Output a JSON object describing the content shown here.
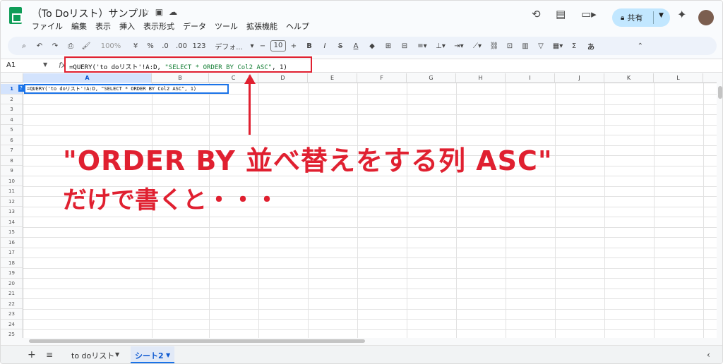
{
  "doc": {
    "title": "（To Doリスト）サンプル"
  },
  "menu": [
    "ファイル",
    "編集",
    "表示",
    "挿入",
    "表示形式",
    "データ",
    "ツール",
    "拡張機能",
    "ヘルプ"
  ],
  "share": {
    "label": "共有"
  },
  "toolbar": {
    "zoom": "100%",
    "currency": "¥",
    "percent": "%",
    "dec_dec": ".0",
    "dec_inc": ".00",
    "num_fmt": "123",
    "font": "デフォ...",
    "font_size": "10",
    "bold": "B",
    "italic": "I",
    "strike": "S",
    "text_color": "A",
    "sigma": "Σ",
    "input_mode": "あ"
  },
  "formula_bar": {
    "cell_ref": "A1",
    "fx": "fx",
    "formula_prefix": "=QUERY(",
    "formula_sheet": "'to doリスト'!A:D, ",
    "formula_str": "\"SELECT * ORDER BY Col2 ASC\"",
    "formula_suffix": ", 1)"
  },
  "columns": [
    "A",
    "B",
    "C",
    "D",
    "E",
    "F",
    "G",
    "H",
    "I",
    "J",
    "K",
    "L"
  ],
  "rows": [
    "1",
    "2",
    "3",
    "4",
    "5",
    "6",
    "7",
    "8",
    "9",
    "10",
    "11",
    "12",
    "13",
    "14",
    "15",
    "16",
    "17",
    "18",
    "19",
    "20",
    "21",
    "22",
    "23",
    "24",
    "25"
  ],
  "cell_a1": "=QUERY('to doリスト'!A:D, \"SELECT * ORDER BY Col2 ASC\", 1)",
  "cell_hint": "?",
  "annotation": {
    "line1": "\"ORDER BY 並べ替えをする列 ASC\"",
    "line2": "だけで書くと・・・"
  },
  "sheets": [
    {
      "name": "to doリスト"
    },
    {
      "name": "シート2",
      "active": true
    }
  ],
  "colors": {
    "accent": "#1a73e8",
    "annotation": "#e02030",
    "share_bg": "#c2e7ff"
  }
}
